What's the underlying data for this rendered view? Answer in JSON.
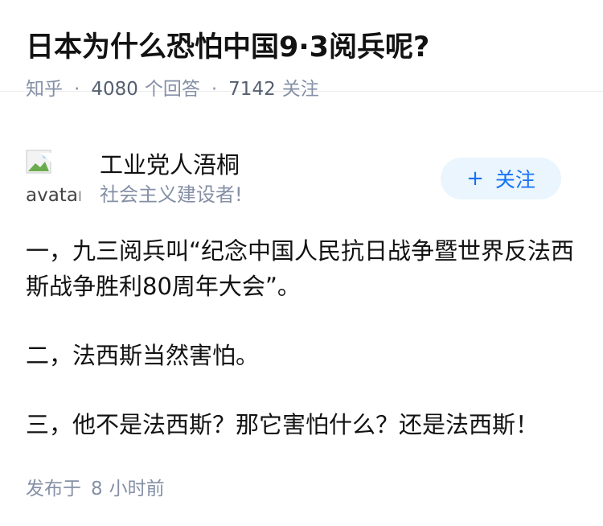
{
  "question": {
    "title": "日本为什么恐怕中国9·3阅兵呢?",
    "source": "知乎",
    "answer_count": "4080",
    "answer_label": "个回答",
    "follow_count": "7142",
    "follow_label": "关注"
  },
  "author": {
    "avatar_alt": "avatar",
    "name": "工业党人浯桐",
    "bio": "社会主义建设者!",
    "follow_button": {
      "icon": "+",
      "label": "关注"
    }
  },
  "answer": {
    "paragraphs": [
      "一，九三阅兵叫“纪念中国人民抗日战争暨世界反法西斯战争胜利80周年大会”。",
      "二，法西斯当然害怕。",
      "三，他不是法西斯？那它害怕什么？还是法西斯！"
    ]
  },
  "footer": {
    "published_prefix": "发布于",
    "published_num": "8",
    "published_unit": "小时前"
  }
}
